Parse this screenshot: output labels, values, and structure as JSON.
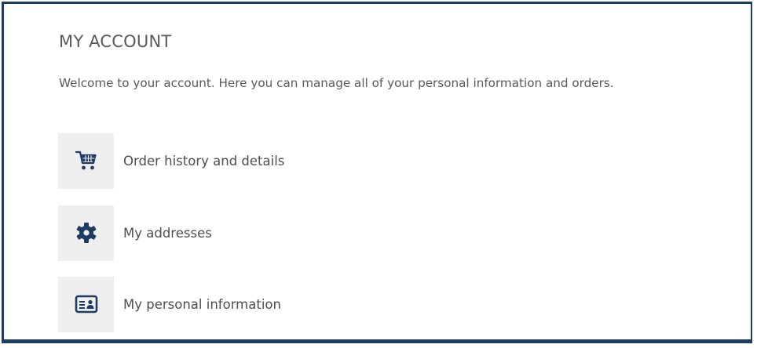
{
  "page": {
    "title": "MY ACCOUNT",
    "welcome": "Welcome to your account. Here you can manage all of your personal information and orders."
  },
  "menu": {
    "items": [
      {
        "label": "Order history and details",
        "icon": "shopping-cart-icon"
      },
      {
        "label": "My addresses",
        "icon": "gear-icon"
      },
      {
        "label": "My personal information",
        "icon": "id-card-icon"
      }
    ]
  },
  "colors": {
    "accent": "#1d3b63",
    "icon_background": "#efefef",
    "text": "#4a4a4a"
  }
}
